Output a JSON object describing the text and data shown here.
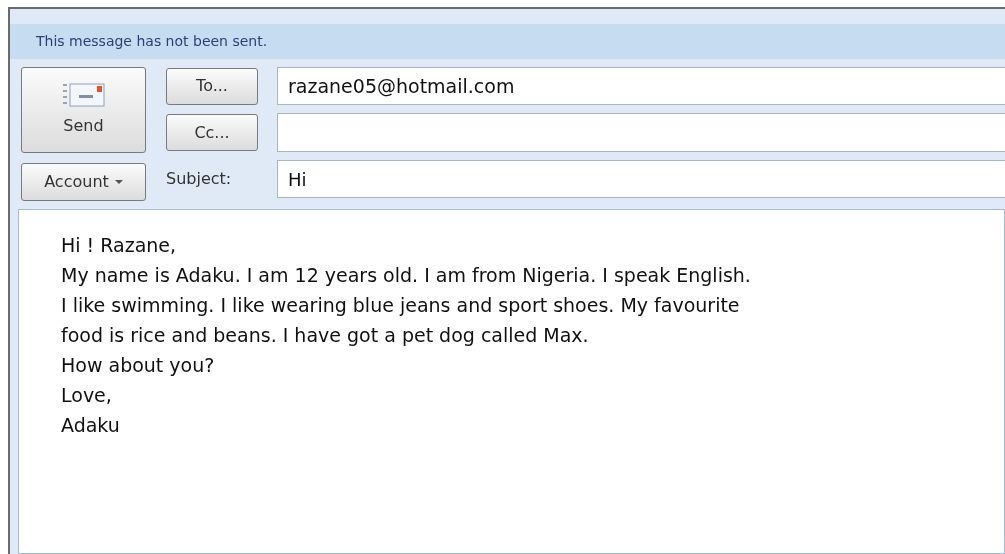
{
  "info_bar": "This message has not been sent.",
  "send_button": "Send",
  "to_button": "To...",
  "to_value": "razane05@hotmail.com",
  "cc_button": "Cc...",
  "account_button": "Account",
  "subject_label": "Subject:",
  "subject_value": "Hi",
  "body_lines": [
    "Hi ! Razane,",
    "My name is Adaku. I am 12 years old. I am from Nigeria. I speak English.",
    "I like swimming. I like wearing blue jeans and sport shoes. My favourite",
    "food is rice and beans. I have got a pet dog called Max.",
    "How about you?",
    "Love,",
    "Adaku"
  ]
}
